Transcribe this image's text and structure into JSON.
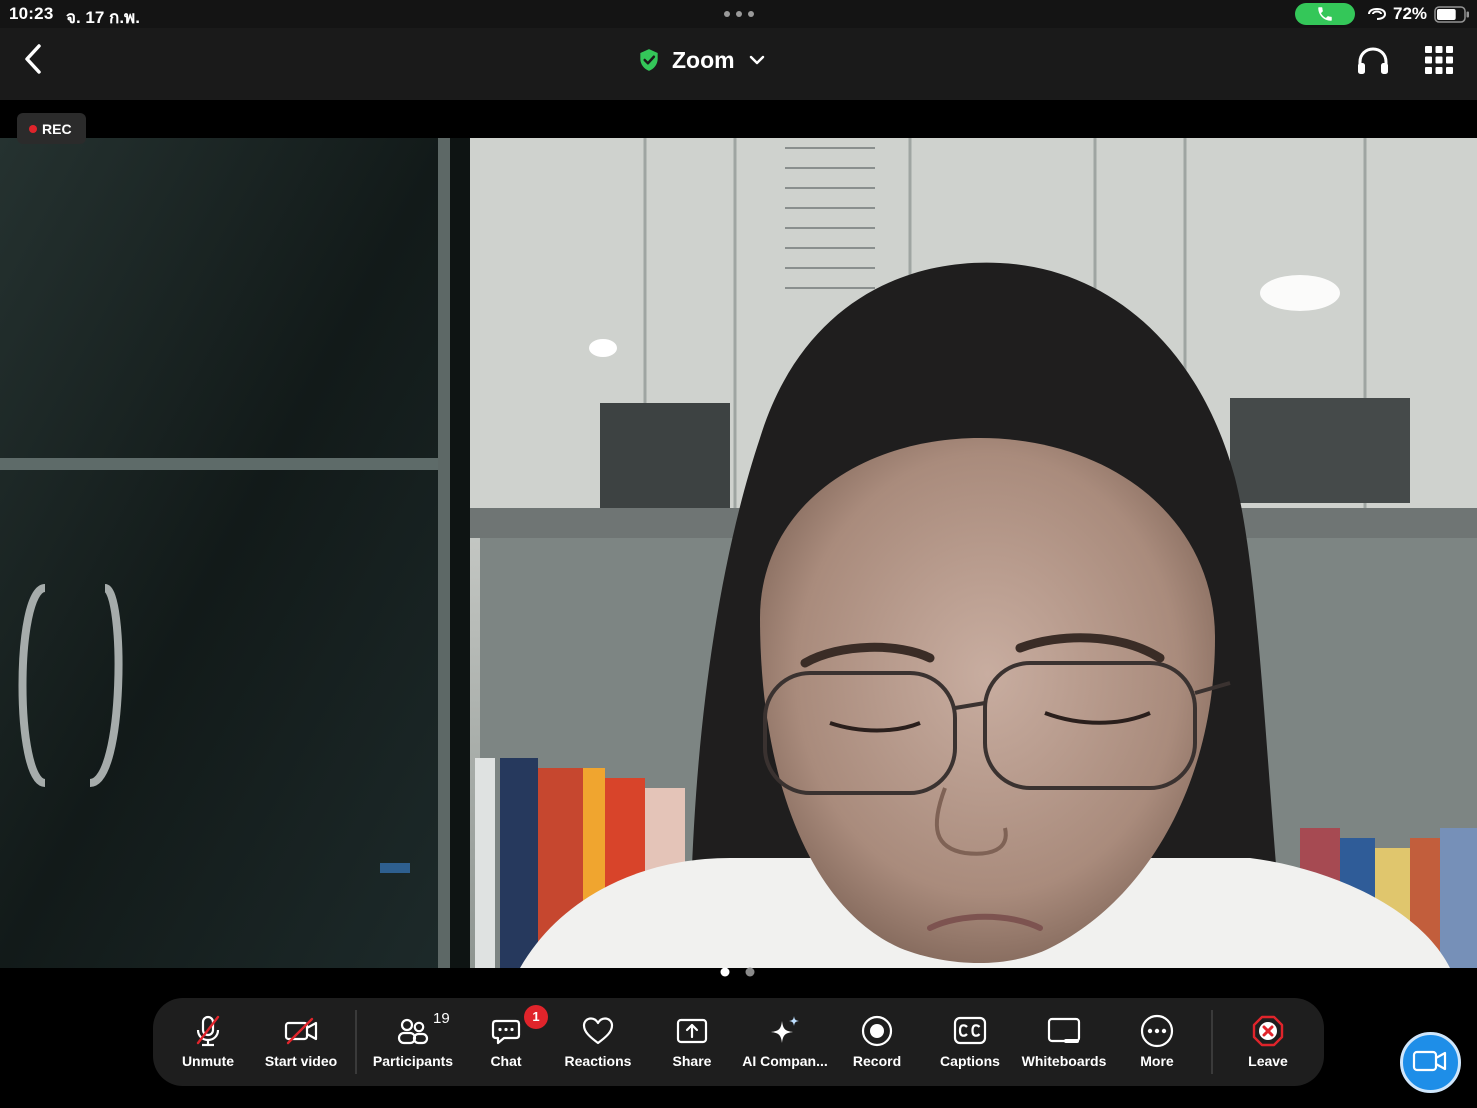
{
  "status_bar": {
    "time": "10:23",
    "date": "จ. 17 ก.พ.",
    "battery_percent": "72%",
    "battery_level": 0.72,
    "call_pill_color": "#34c759"
  },
  "header": {
    "title": "Zoom",
    "verified_icon": "shield-check-icon",
    "verified_color": "#34c759"
  },
  "video": {
    "rec_label": "REC",
    "rec_color": "#e0242b",
    "page_count": 2,
    "active_page": 1
  },
  "toolbar": {
    "unmute_label": "Unmute",
    "start_video_label": "Start video",
    "participants_label": "Participants",
    "participants_count": "19",
    "chat_label": "Chat",
    "chat_badge": "1",
    "reactions_label": "Reactions",
    "share_label": "Share",
    "ai_label": "AI Compan...",
    "record_label": "Record",
    "captions_label": "Captions",
    "whiteboards_label": "Whiteboards",
    "more_label": "More",
    "leave_label": "Leave",
    "leave_color": "#e0242b",
    "camera_fab_color": "#1e8ee8"
  }
}
